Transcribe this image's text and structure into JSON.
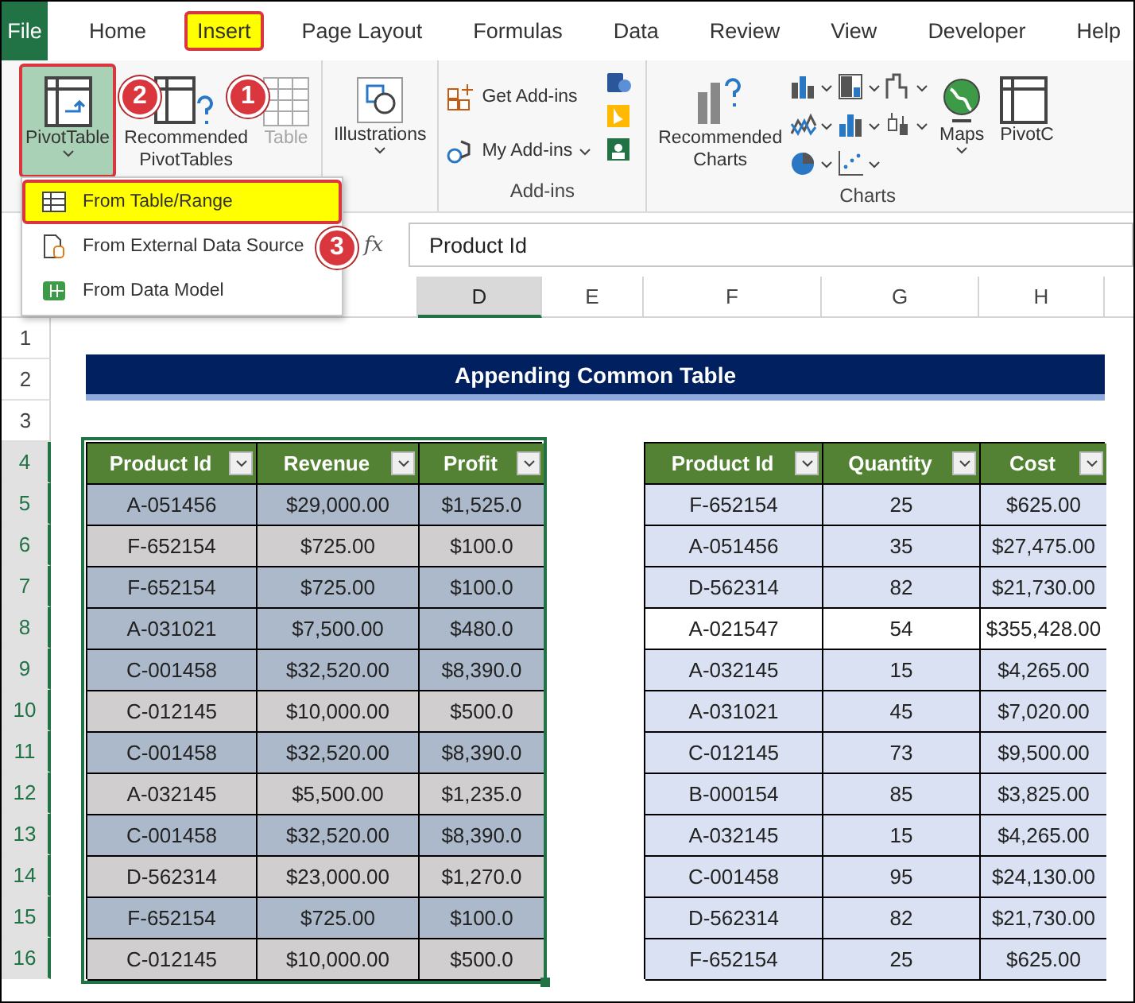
{
  "ribbon_tabs": [
    {
      "label": "File",
      "kind": "file",
      "selected": false
    },
    {
      "label": "Home",
      "kind": "tab",
      "selected": false
    },
    {
      "label": "Insert",
      "kind": "tab",
      "selected": true
    },
    {
      "label": "Page Layout",
      "kind": "tab",
      "selected": false
    },
    {
      "label": "Formulas",
      "kind": "tab",
      "selected": false
    },
    {
      "label": "Data",
      "kind": "tab",
      "selected": false
    },
    {
      "label": "Review",
      "kind": "tab",
      "selected": false
    },
    {
      "label": "View",
      "kind": "tab",
      "selected": false
    },
    {
      "label": "Developer",
      "kind": "tab",
      "selected": false
    },
    {
      "label": "Help",
      "kind": "tab",
      "selected": false
    }
  ],
  "ribbon": {
    "tables": [
      {
        "kind": "pivot-table",
        "lines": [
          "PivotTable"
        ],
        "selected": true,
        "disabled": false
      },
      {
        "kind": "recommended-pivot",
        "lines": [
          "Recommended",
          "PivotTables"
        ],
        "selected": false,
        "disabled": false
      },
      {
        "kind": "table",
        "lines": [
          "Table"
        ],
        "selected": false,
        "disabled": true
      }
    ],
    "illustrations": {
      "label": "Illustrations"
    },
    "addins": {
      "items": [
        {
          "kind": "get",
          "label": "Get Add-ins"
        },
        {
          "kind": "my",
          "label": "My Add-ins"
        }
      ],
      "group_label": "Add-ins"
    },
    "charts": {
      "recommended": [
        "Recommended",
        "Charts"
      ],
      "types": [
        {
          "kind": "column"
        },
        {
          "kind": "line"
        },
        {
          "kind": "pie"
        },
        {
          "kind": "treemap"
        },
        {
          "kind": "bar"
        },
        {
          "kind": "scatter"
        },
        {
          "kind": "waterfall"
        },
        {
          "kind": "boxplot"
        }
      ],
      "maps": "Maps",
      "pivot_chart": "PivotC",
      "group_label": "Charts"
    }
  },
  "callouts": [
    "1",
    "2",
    "3"
  ],
  "menu": {
    "items": [
      {
        "kind": "table",
        "label": "From Table/Range",
        "selected": true
      },
      {
        "kind": "external",
        "label": "From External Data Source",
        "selected": false
      },
      {
        "kind": "model",
        "label": "From Data Model",
        "selected": false
      }
    ]
  },
  "formula_bar": {
    "function_label": "fx",
    "value": "Product Id"
  },
  "column_headers": [
    {
      "label": "D",
      "selected": true
    },
    {
      "label": "E",
      "selected": false
    },
    {
      "label": "F",
      "selected": false
    },
    {
      "label": "G",
      "selected": false
    },
    {
      "label": "H",
      "selected": false
    }
  ],
  "row_headers": [
    {
      "label": "1",
      "selected": false
    },
    {
      "label": "2",
      "selected": false
    },
    {
      "label": "3",
      "selected": false
    },
    {
      "label": "4",
      "selected": true
    },
    {
      "label": "5",
      "selected": true
    },
    {
      "label": "6",
      "selected": true
    },
    {
      "label": "7",
      "selected": true
    },
    {
      "label": "8",
      "selected": true
    },
    {
      "label": "9",
      "selected": true
    },
    {
      "label": "10",
      "selected": true
    },
    {
      "label": "11",
      "selected": true
    },
    {
      "label": "12",
      "selected": true
    },
    {
      "label": "13",
      "selected": true
    },
    {
      "label": "14",
      "selected": true
    },
    {
      "label": "15",
      "selected": true
    },
    {
      "label": "16",
      "selected": true
    }
  ],
  "title": "Appending Common Table",
  "left_table": {
    "selected": true,
    "columns": [
      "Product Id",
      "Revenue",
      "Profit"
    ],
    "rows": [
      {
        "cells": [
          "A-051456",
          "$29,000.00",
          "$1,525.0"
        ],
        "color": "#acb9ca"
      },
      {
        "cells": [
          "F-652154",
          "$725.00",
          "$100.0"
        ],
        "color": "#d0cece"
      },
      {
        "cells": [
          "F-652154",
          "$725.00",
          "$100.0"
        ],
        "color": "#acb9ca"
      },
      {
        "cells": [
          "A-031021",
          "$7,500.00",
          "$480.0"
        ],
        "color": "#acb9ca"
      },
      {
        "cells": [
          "C-001458",
          "$32,520.00",
          "$8,390.0"
        ],
        "color": "#acb9ca"
      },
      {
        "cells": [
          "C-012145",
          "$10,000.00",
          "$500.0"
        ],
        "color": "#d0cece"
      },
      {
        "cells": [
          "C-001458",
          "$32,520.00",
          "$8,390.0"
        ],
        "color": "#acb9ca"
      },
      {
        "cells": [
          "A-032145",
          "$5,500.00",
          "$1,235.0"
        ],
        "color": "#d0cece"
      },
      {
        "cells": [
          "C-001458",
          "$32,520.00",
          "$8,390.0"
        ],
        "color": "#acb9ca"
      },
      {
        "cells": [
          "D-562314",
          "$23,000.00",
          "$1,270.0"
        ],
        "color": "#d0cece"
      },
      {
        "cells": [
          "F-652154",
          "$725.00",
          "$100.0"
        ],
        "color": "#acb9ca"
      },
      {
        "cells": [
          "C-012145",
          "$10,000.00",
          "$500.0"
        ],
        "color": "#d0cece"
      }
    ]
  },
  "right_table": {
    "columns": [
      "Product Id",
      "Quantity",
      "Cost"
    ],
    "rows": [
      {
        "cells": [
          "F-652154",
          "25",
          "$625.00"
        ],
        "color": "#d9e1f2"
      },
      {
        "cells": [
          "A-051456",
          "35",
          "$27,475.00"
        ],
        "color": "#d9e1f2"
      },
      {
        "cells": [
          "D-562314",
          "82",
          "$21,730.00"
        ],
        "color": "#d9e1f2"
      },
      {
        "cells": [
          "A-021547",
          "54",
          "$355,428.00"
        ],
        "color": "#ffffff"
      },
      {
        "cells": [
          "A-032145",
          "15",
          "$4,265.00"
        ],
        "color": "#d9e1f2"
      },
      {
        "cells": [
          "A-031021",
          "45",
          "$7,020.00"
        ],
        "color": "#d9e1f2"
      },
      {
        "cells": [
          "C-012145",
          "73",
          "$9,500.00"
        ],
        "color": "#d9e1f2"
      },
      {
        "cells": [
          "B-000154",
          "85",
          "$3,825.00"
        ],
        "color": "#d9e1f2"
      },
      {
        "cells": [
          "A-032145",
          "15",
          "$4,265.00"
        ],
        "color": "#d9e1f2"
      },
      {
        "cells": [
          "C-001458",
          "95",
          "$24,130.00"
        ],
        "color": "#d9e1f2"
      },
      {
        "cells": [
          "D-562314",
          "82",
          "$21,730.00"
        ],
        "color": "#d9e1f2"
      },
      {
        "cells": [
          "F-652154",
          "25",
          "$625.00"
        ],
        "color": "#d9e1f2"
      }
    ]
  }
}
